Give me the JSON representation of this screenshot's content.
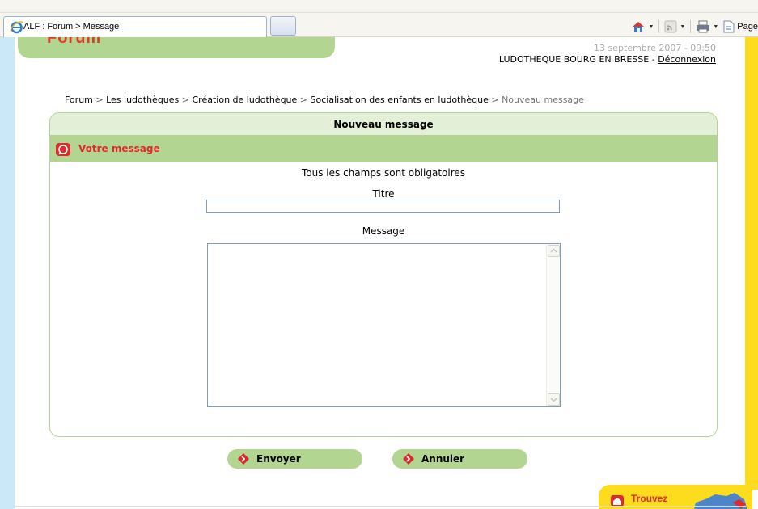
{
  "browser": {
    "tab_title": "ALF : Forum > Message",
    "page_menu_label": "Page"
  },
  "header": {
    "logo_text": "Forum",
    "datetime": "13 septembre 2007 - 09:50",
    "user_name": "LUDOTHEQUE BOURG EN BRESSE",
    "user_sep": " - ",
    "logout_label": "Déconnexion"
  },
  "breadcrumb": {
    "items": [
      "Forum",
      "Les ludothèques",
      "Création de ludothèque",
      "Socialisation des enfants en ludothèque"
    ],
    "separator": " > ",
    "current": "Nouveau message"
  },
  "form": {
    "panel_title": "Nouveau message",
    "section_title": "Votre message",
    "required_note": "Tous les champs sont obligatoires",
    "title_label": "Titre",
    "title_value": "",
    "message_label": "Message",
    "message_value": ""
  },
  "actions": {
    "send_label": "Envoyer",
    "cancel_label": "Annuler"
  },
  "promo": {
    "label": "Trouvez"
  },
  "colors": {
    "accent_green": "#b2d591",
    "accent_red": "#e0292b",
    "side_blue": "#cbe8f8",
    "side_yellow": "#fddc1e"
  }
}
